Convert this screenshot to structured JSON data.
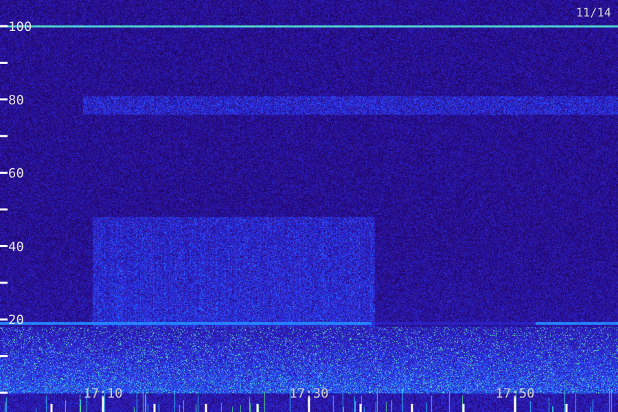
{
  "chart_data": {
    "type": "heatmap",
    "title": "",
    "date_label": "11/14",
    "ylim": [
      0,
      100
    ],
    "y_major_ticks": [
      0,
      20,
      40,
      60,
      80,
      100
    ],
    "y_tick_labels": [
      "",
      "20",
      "40",
      "60",
      "80",
      "100"
    ],
    "y_minor_ticks": [
      10,
      30,
      50,
      70,
      90
    ],
    "x_tick_labels": [
      "17:10",
      "17:30",
      "17:50"
    ],
    "xlim_minutes": [
      "17:05",
      "17:55"
    ],
    "colormap": [
      "#0a0028",
      "#2a0a8a",
      "#2f3cff",
      "#1fb6ff",
      "#7dffb0"
    ],
    "features": [
      {
        "kind": "horizontal-line",
        "value": 100,
        "color": "#34e6ff",
        "intensity": 0.95
      },
      {
        "kind": "horizontal-band",
        "from": 76,
        "to": 81,
        "color": "#3a1ecc",
        "intensity": 0.55
      },
      {
        "kind": "broadband-noise",
        "from_time": "17:09",
        "to_time": "17:35",
        "from": 18,
        "to": 48,
        "color": "#2a3cff",
        "intensity": 0.55
      },
      {
        "kind": "horizontal-line",
        "value": 19,
        "color": "#3aff9a",
        "intensity": 0.7
      },
      {
        "kind": "low-frequency-noise",
        "from": 0,
        "to": 18,
        "color": "#22c3ff",
        "intensity": 0.75
      }
    ]
  }
}
